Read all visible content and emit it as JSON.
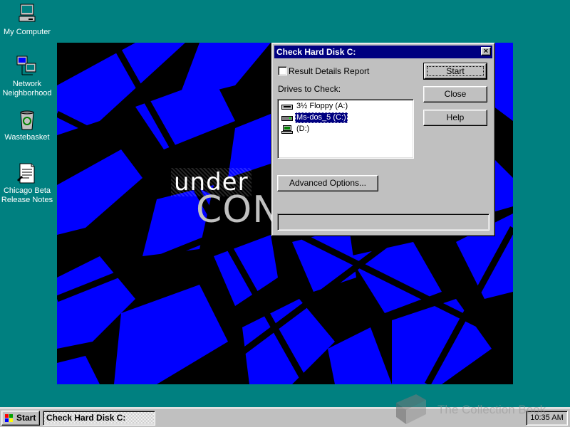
{
  "desktop": {
    "icons": [
      {
        "label_lines": [
          "My Computer"
        ],
        "icon": "my-computer-icon"
      },
      {
        "label_lines": [
          "Network",
          "Neighborhood"
        ],
        "icon": "network-neighborhood-icon"
      },
      {
        "label_lines": [
          "Wastebasket"
        ],
        "icon": "wastebasket-icon"
      },
      {
        "label_lines": [
          "Chicago Beta",
          "Release Notes"
        ],
        "icon": "release-notes-icon"
      }
    ],
    "wallpaper": {
      "line1": "under",
      "line2": "CONS"
    }
  },
  "dialog": {
    "title": "Check Hard Disk C:",
    "checkbox_label": "Result Details Report",
    "checkbox_checked": false,
    "drives_label": "Drives to Check:",
    "drives": [
      {
        "label": "3½ Floppy (A:)",
        "icon": "floppy-drive-icon",
        "selected": false
      },
      {
        "label": "Ms-dos_5 (C:)",
        "icon": "hard-disk-icon",
        "selected": true
      },
      {
        "label": "(D:)",
        "icon": "network-drive-icon",
        "selected": false
      }
    ],
    "buttons": {
      "start": "Start",
      "close": "Close",
      "help": "Help",
      "advanced": "Advanced Options..."
    }
  },
  "taskbar": {
    "start_label": "Start",
    "task_label": "Check Hard Disk C:",
    "clock": "10:35 AM"
  },
  "watermark": {
    "text": "The Collection Book"
  },
  "colors": {
    "desktop": "#008080",
    "titlebar": "#000080",
    "face": "#c0c0c0",
    "wallpaper_blue": "#0000ff"
  }
}
